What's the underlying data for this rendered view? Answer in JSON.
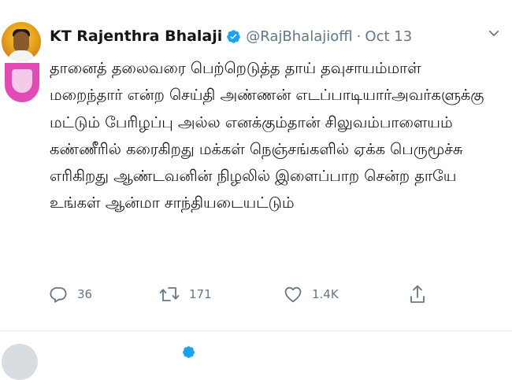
{
  "tweet": {
    "author_name": "KT Rajenthra Bhalaji",
    "handle": "@RajBhalajioffl",
    "separator": "·",
    "date": "Oct 13",
    "body_lines": [
      "தானைத் தலைவரை பெற்றெடுத்த தாய் தவுசாயம்மாள்",
      "மறைந்தார் என்ற செய்தி அண்ணன் எடப்பாடியார்அவர்களுக்கு",
      "மட்டும் பேரிழப்பு அல்ல எனக்கும்தான் சிலுவம்பாளையம்",
      "கண்ணீரில் கரைகிறது மக்கள் நெஞ்சங்களில் ஏக்க பெருமூச்சு",
      "எரிகிறது ஆண்டவனின்  நிழலில் இளைப்பாற சென்ற தாயே",
      "உங்கள் ஆன்மா சாந்தியடையட்டும்"
    ],
    "actions": {
      "reply_count": "36",
      "retweet_count": "171",
      "like_count": "1.4K"
    }
  },
  "icons": {
    "verified": "verified-badge-icon",
    "menu": "chevron-down-icon",
    "reply": "reply-icon",
    "retweet": "retweet-icon",
    "like": "heart-icon",
    "share": "share-icon"
  },
  "colors": {
    "text": "#14171a",
    "secondary": "#657786",
    "verified": "#1da1f2",
    "divider": "#e6ecf0"
  }
}
